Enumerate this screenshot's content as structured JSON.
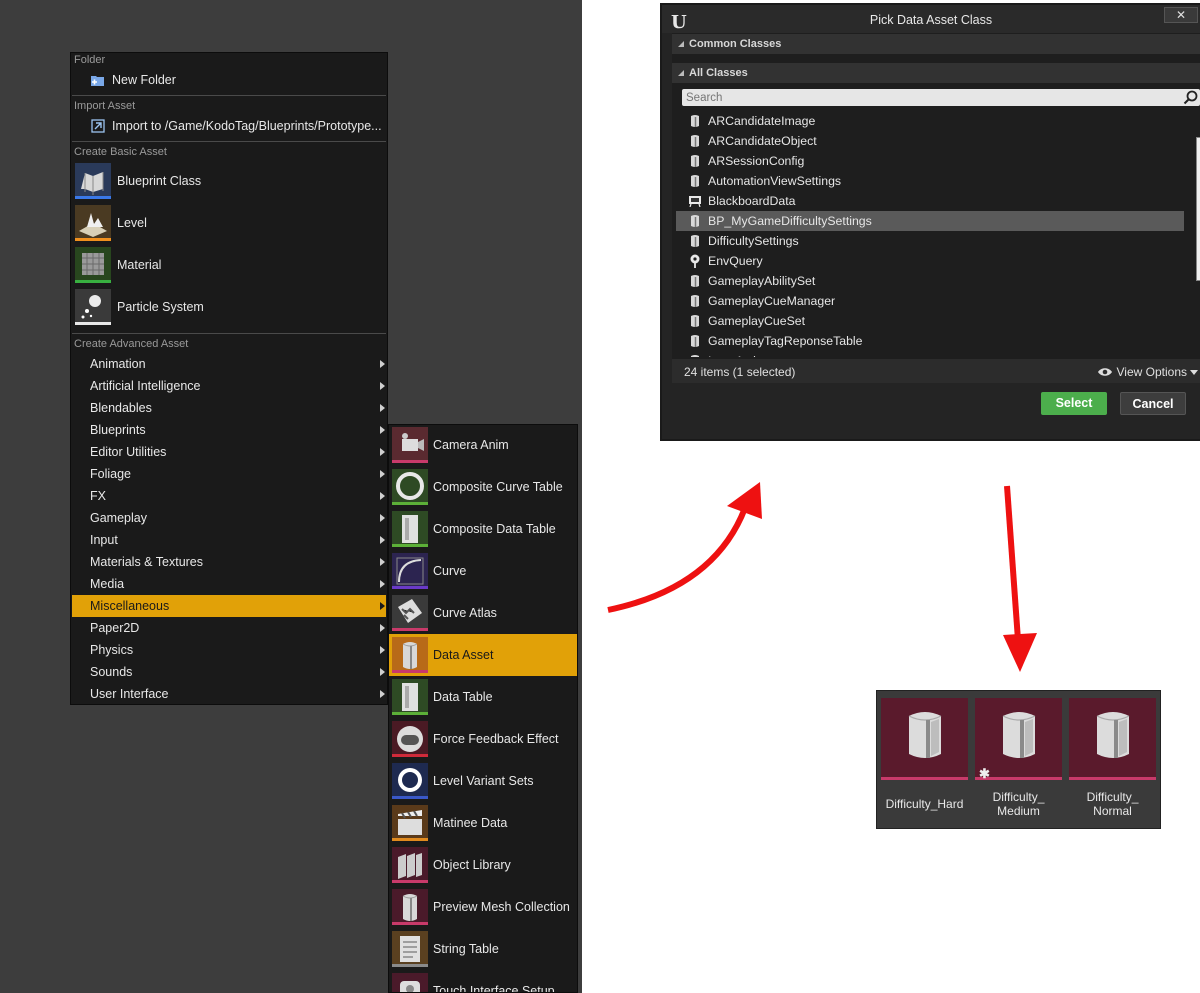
{
  "menu": {
    "folder_heading": "Folder",
    "new_folder": "New Folder",
    "import_heading": "Import Asset",
    "import_to": "Import to /Game/KodoTag/Blueprints/Prototype...",
    "basic_heading": "Create Basic Asset",
    "basic_items": [
      {
        "label": "Blueprint Class",
        "icon": "blueprint-class-icon",
        "color": "#3a78e8"
      },
      {
        "label": "Level",
        "icon": "level-icon",
        "color": "#f0901e"
      },
      {
        "label": "Material",
        "icon": "material-icon",
        "color": "#38b040"
      },
      {
        "label": "Particle System",
        "icon": "particle-system-icon",
        "color": "#e8e8e8"
      }
    ],
    "advanced_heading": "Create Advanced Asset",
    "advanced_items": [
      {
        "label": "Animation"
      },
      {
        "label": "Artificial Intelligence"
      },
      {
        "label": "Blendables"
      },
      {
        "label": "Blueprints"
      },
      {
        "label": "Editor Utilities"
      },
      {
        "label": "Foliage"
      },
      {
        "label": "FX"
      },
      {
        "label": "Gameplay"
      },
      {
        "label": "Input"
      },
      {
        "label": "Materials & Textures"
      },
      {
        "label": "Media"
      },
      {
        "label": "Miscellaneous",
        "highlighted": true
      },
      {
        "label": "Paper2D"
      },
      {
        "label": "Physics"
      },
      {
        "label": "Sounds"
      },
      {
        "label": "User Interface"
      }
    ]
  },
  "submenu": {
    "items": [
      {
        "label": "Camera Anim",
        "icon": "camera-anim-icon",
        "bg": "#5a2a30",
        "color": "#c83a6a"
      },
      {
        "label": "Composite Curve Table",
        "icon": "composite-curve-table-icon",
        "bg": "#2e4a24",
        "color": "#5cb038"
      },
      {
        "label": "Composite Data Table",
        "icon": "composite-data-table-icon",
        "bg": "#2e4a24",
        "color": "#5cb038"
      },
      {
        "label": "Curve",
        "icon": "curve-icon",
        "bg": "#2c2450",
        "color": "#6a3ac8"
      },
      {
        "label": "Curve Atlas",
        "icon": "curve-atlas-icon",
        "bg": "#3a3a3a",
        "color": "#c83a6a"
      },
      {
        "label": "Data Asset",
        "icon": "data-asset-icon",
        "bg": "#b86a18",
        "color": "#c83a6a",
        "highlighted": true
      },
      {
        "label": "Data Table",
        "icon": "data-table-icon",
        "bg": "#2e4a24",
        "color": "#5cb038"
      },
      {
        "label": "Force Feedback Effect",
        "icon": "force-feedback-icon",
        "bg": "#4a1a24",
        "color": "#d02a3a"
      },
      {
        "label": "Level Variant Sets",
        "icon": "level-variant-sets-icon",
        "bg": "#1e2a50",
        "color": "#3a58c8"
      },
      {
        "label": "Matinee Data",
        "icon": "matinee-data-icon",
        "bg": "#5a3a1a",
        "color": "#e08a1e"
      },
      {
        "label": "Object Library",
        "icon": "object-library-icon",
        "bg": "#4a1a2a",
        "color": "#c83a6a"
      },
      {
        "label": "Preview Mesh Collection",
        "icon": "preview-mesh-collection-icon",
        "bg": "#4a1a2a",
        "color": "#c83a6a"
      },
      {
        "label": "String Table",
        "icon": "string-table-icon",
        "bg": "#5a4020",
        "color": "#8a8a8a"
      },
      {
        "label": "Touch Interface Setup",
        "icon": "touch-interface-setup-icon",
        "bg": "#4a1a2a",
        "color": "#c83a6a"
      }
    ]
  },
  "dialog": {
    "title": "Pick Data Asset Class",
    "close_label": "✕",
    "common_classes": "Common Classes",
    "all_classes": "All Classes",
    "search_placeholder": "Search",
    "classes": [
      {
        "label": "ARCandidateImage",
        "icon": "data-asset-icon"
      },
      {
        "label": "ARCandidateObject",
        "icon": "data-asset-icon"
      },
      {
        "label": "ARSessionConfig",
        "icon": "data-asset-icon"
      },
      {
        "label": "AutomationViewSettings",
        "icon": "data-asset-icon"
      },
      {
        "label": "BlackboardData",
        "icon": "blackboard-icon"
      },
      {
        "label": "BP_MyGameDifficultySettings",
        "icon": "data-asset-icon",
        "selected": true
      },
      {
        "label": "DifficultySettings",
        "icon": "data-asset-icon"
      },
      {
        "label": "EnvQuery",
        "icon": "env-query-icon"
      },
      {
        "label": "GameplayAbilitySet",
        "icon": "data-asset-icon"
      },
      {
        "label": "GameplayCueManager",
        "icon": "data-asset-icon"
      },
      {
        "label": "GameplayCueSet",
        "icon": "data-asset-icon"
      },
      {
        "label": "GameplayTagReponseTable",
        "icon": "data-asset-icon"
      },
      {
        "label": "InputAction",
        "icon": "data-asset-icon"
      }
    ],
    "items_count": "24 items (1 selected)",
    "view_options": "View Options",
    "select_label": "Select",
    "cancel_label": "Cancel"
  },
  "assets": [
    {
      "label": "Difficulty_Hard",
      "dirty": false
    },
    {
      "label": "Difficulty_\nMedium",
      "dirty": true
    },
    {
      "label": "Difficulty_\nNormal",
      "dirty": false
    }
  ],
  "colors": {
    "highlight": "#e1a108",
    "arrow": "#ee1111",
    "select_button": "#4cae4c"
  }
}
